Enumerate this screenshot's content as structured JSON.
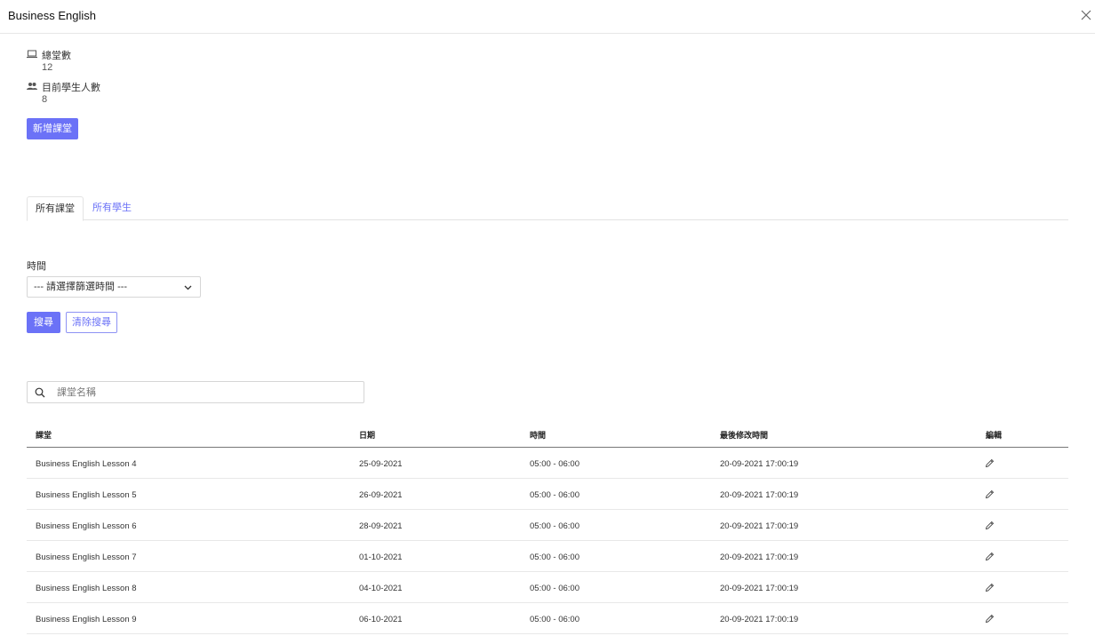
{
  "modal": {
    "title": "Business English",
    "close_icon": "close-icon"
  },
  "stats": [
    {
      "icon": "laptop-icon",
      "label": "總堂數",
      "value": "12"
    },
    {
      "icon": "users-icon",
      "label": "目前學生人數",
      "value": "8"
    }
  ],
  "add_lesson_label": "新增課堂",
  "tabs": [
    {
      "label": "所有課堂",
      "active": true
    },
    {
      "label": "所有學生",
      "active": false
    }
  ],
  "filter": {
    "time_label": "時間",
    "time_selected": "--- 請選擇篩選時間 ---",
    "search_label": "搜尋",
    "clear_label": "清除搜尋"
  },
  "search": {
    "placeholder": "課堂名稱"
  },
  "table": {
    "headers": [
      "課堂",
      "日期",
      "時間",
      "最後修改時間",
      "編輯"
    ],
    "rows": [
      {
        "lesson": "Business English Lesson 4",
        "date": "25-09-2021",
        "time": "05:00 - 06:00",
        "modified": "20-09-2021 17:00:19"
      },
      {
        "lesson": "Business English Lesson 5",
        "date": "26-09-2021",
        "time": "05:00 - 06:00",
        "modified": "20-09-2021 17:00:19"
      },
      {
        "lesson": "Business English Lesson 6",
        "date": "28-09-2021",
        "time": "05:00 - 06:00",
        "modified": "20-09-2021 17:00:19"
      },
      {
        "lesson": "Business English Lesson 7",
        "date": "01-10-2021",
        "time": "05:00 - 06:00",
        "modified": "20-09-2021 17:00:19"
      },
      {
        "lesson": "Business English Lesson 8",
        "date": "04-10-2021",
        "time": "05:00 - 06:00",
        "modified": "20-09-2021 17:00:19"
      },
      {
        "lesson": "Business English Lesson 9",
        "date": "06-10-2021",
        "time": "05:00 - 06:00",
        "modified": "20-09-2021 17:00:19"
      }
    ]
  },
  "colors": {
    "accent": "#6b72f7",
    "border": "#d6d6d6",
    "text": "#333333"
  }
}
